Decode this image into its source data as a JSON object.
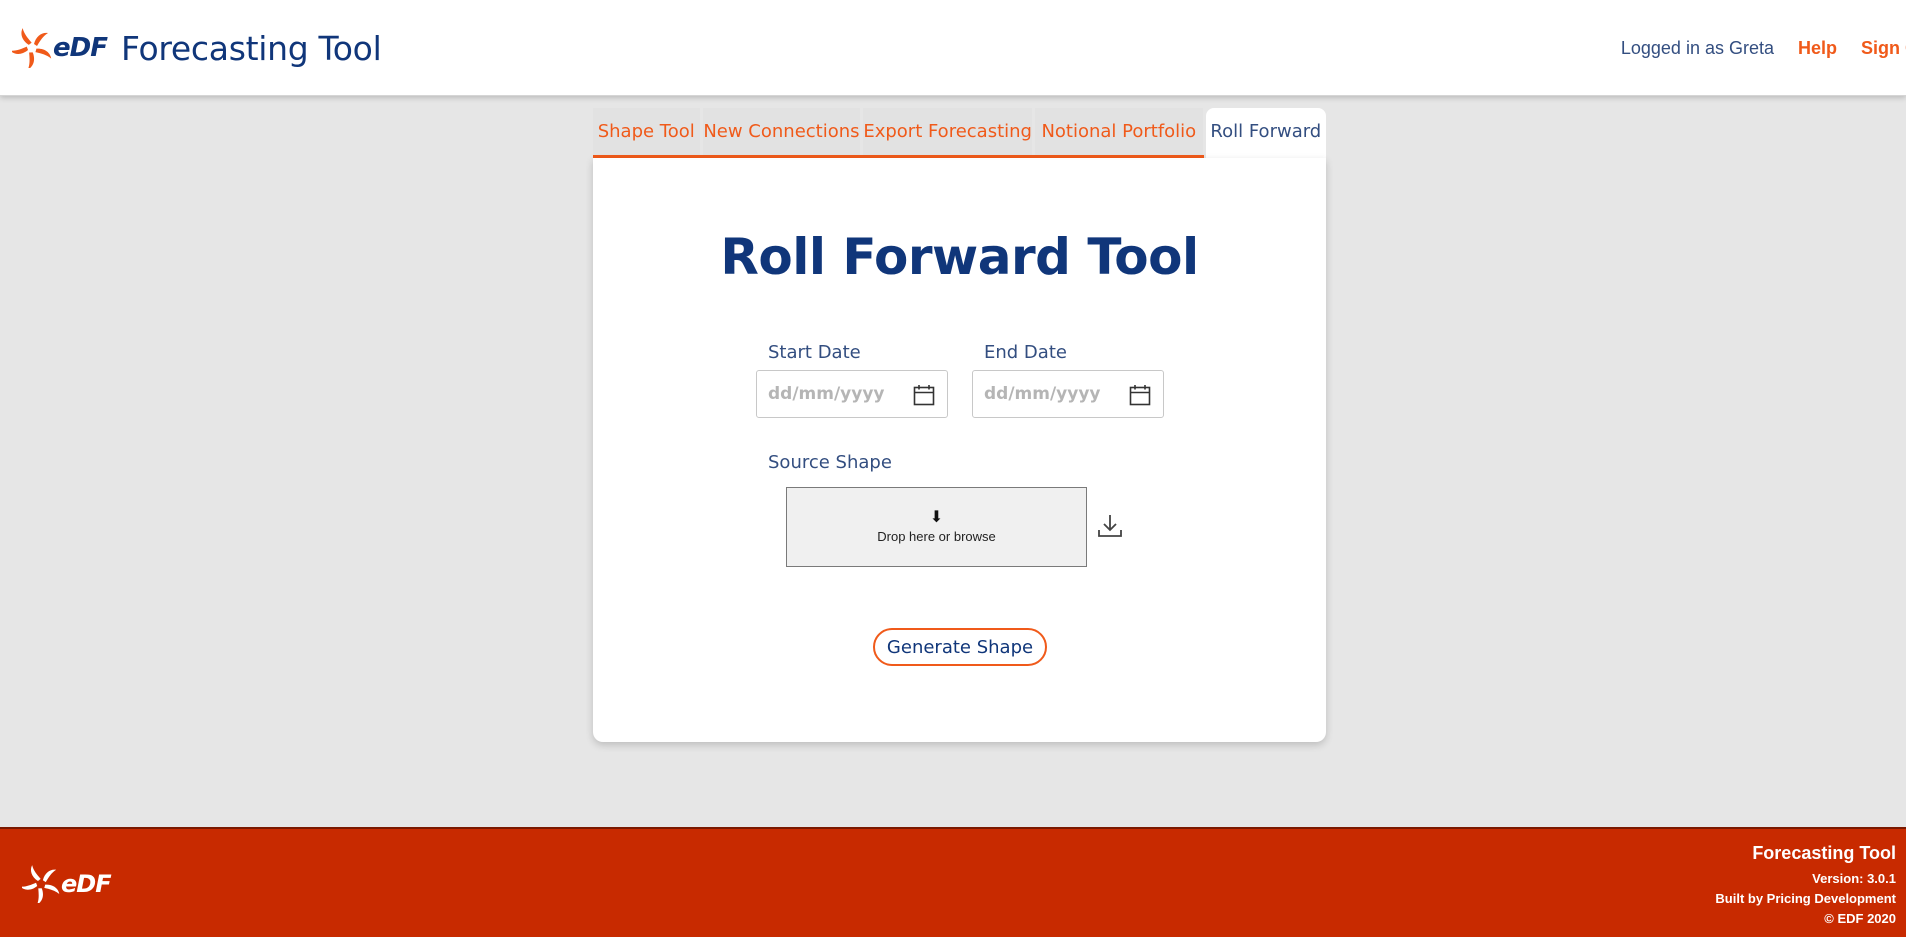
{
  "header": {
    "brand_logo_text": "eDF",
    "app_title": "Forecasting Tool",
    "user_label": "Logged in as Greta",
    "help_label": "Help",
    "signout_label": "Sign Out"
  },
  "tabs": [
    {
      "label": "Shape Tool",
      "active": false
    },
    {
      "label": "New Connections",
      "active": false
    },
    {
      "label": "Export Forecasting",
      "active": false
    },
    {
      "label": "Notional Portfolio",
      "active": false
    },
    {
      "label": "Roll Forward",
      "active": true
    }
  ],
  "main": {
    "title": "Roll Forward Tool",
    "start_date": {
      "label": "Start Date",
      "placeholder": "dd/mm/yyyy",
      "icon": "calendar-icon"
    },
    "end_date": {
      "label": "End Date",
      "placeholder": "dd/mm/yyyy",
      "icon": "calendar-icon"
    },
    "source_shape": {
      "label": "Source Shape",
      "drop_text": "Drop here or browse",
      "drop_icon": "down-arrow-icon",
      "download_icon": "download-icon"
    },
    "generate_label": "Generate Shape"
  },
  "footer": {
    "logo_text": "eDF",
    "title": "Forecasting Tool",
    "version": "Version: 3.0.1",
    "built_by": "Built by Pricing Development",
    "copyright": "© EDF 2020"
  },
  "colors": {
    "brand_orange": "#f05a1a",
    "brand_blue": "#10367a",
    "footer_red": "#c82a00",
    "page_bg": "#e6e6e6"
  }
}
